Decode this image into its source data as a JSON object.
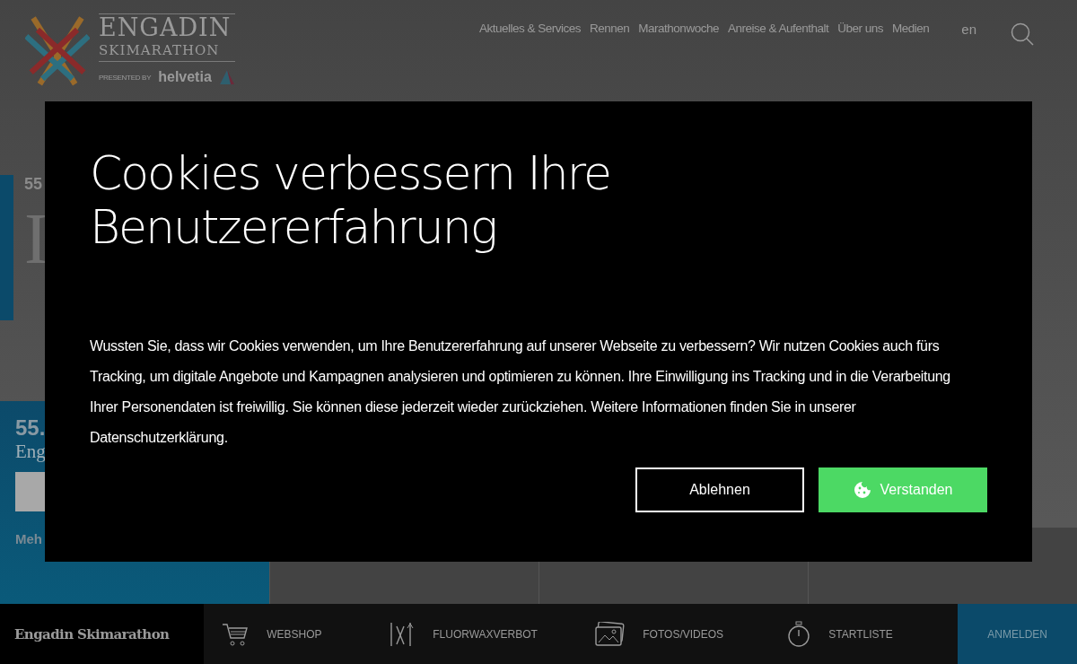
{
  "header": {
    "logo": {
      "line_1": "ENGADIN",
      "line_2": "SKIMARATHON",
      "presented_by": "PRESENTED BY",
      "sponsor": "helvetia"
    },
    "nav": [
      "Aktuelles & Services",
      "Rennen",
      "Marathonwoche",
      "Anreise & Aufenthalt",
      "Über uns",
      "Medien"
    ],
    "language": "en"
  },
  "hero": {
    "kicker": "55",
    "heading": "I"
  },
  "race_panel": {
    "kicker": "55.",
    "title": "Eng",
    "link": "Meh"
  },
  "bottom_bar": {
    "brand": "Engadin Skimarathon",
    "items": [
      {
        "kind": "cart",
        "label": "WEBSHOP"
      },
      {
        "kind": "wax",
        "label": "FLUORWAXVERBOT"
      },
      {
        "kind": "photo",
        "label": "FOTOS/VIDEOS"
      },
      {
        "kind": "stopwatch",
        "label": "STARTLISTE"
      }
    ],
    "cta": "ANMELDEN"
  },
  "cookie_dialog": {
    "title": "Cookies verbessern Ihre Benutzererfahrung",
    "text": "Wussten Sie, dass wir Cookies verwenden, um Ihre Benutzererfahrung auf unserer Webseite zu verbessern? Wir nutzen Cookies auch fürs Tracking, um digitale Angebote und Kampagnen analysieren und optimieren zu können. Ihre Einwilligung ins Tracking und in die Verarbeitung Ihrer Personendaten ist freiwillig. Sie können diese jederzeit wieder zurückziehen. Weitere Informationen finden Sie in unserer Datenschutzerklärung.",
    "buttons": [
      {
        "kind": "decline",
        "label": "Ablehnen"
      },
      {
        "kind": "accept",
        "label": "Verstanden"
      }
    ]
  }
}
